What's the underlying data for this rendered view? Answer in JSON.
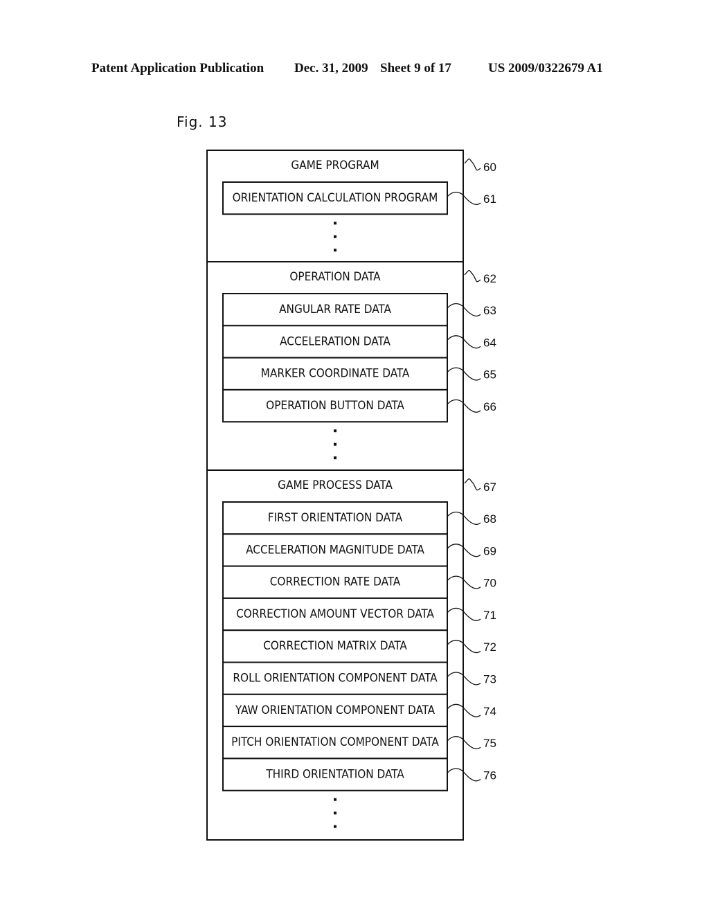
{
  "header": {
    "publication": "Patent Application Publication",
    "date": "Dec. 31, 2009",
    "sheet": "Sheet 9 of 17",
    "number": "US 2009/0322679 A1"
  },
  "figure": {
    "label": "Fig. 13",
    "sections": [
      {
        "title": "GAME PROGRAM",
        "ref": "60",
        "items": [
          {
            "label": "ORIENTATION CALCULATION PROGRAM",
            "ref": "61"
          }
        ],
        "continues": true
      },
      {
        "title": "OPERATION DATA",
        "ref": "62",
        "items": [
          {
            "label": "ANGULAR RATE DATA",
            "ref": "63"
          },
          {
            "label": "ACCELERATION DATA",
            "ref": "64"
          },
          {
            "label": "MARKER COORDINATE DATA",
            "ref": "65"
          },
          {
            "label": "OPERATION BUTTON DATA",
            "ref": "66"
          }
        ],
        "continues": true
      },
      {
        "title": "GAME PROCESS DATA",
        "ref": "67",
        "items": [
          {
            "label": "FIRST ORIENTATION DATA",
            "ref": "68"
          },
          {
            "label": "ACCELERATION MAGNITUDE DATA",
            "ref": "69"
          },
          {
            "label": "CORRECTION RATE DATA",
            "ref": "70"
          },
          {
            "label": "CORRECTION AMOUNT VECTOR DATA",
            "ref": "71"
          },
          {
            "label": "CORRECTION MATRIX DATA",
            "ref": "72"
          },
          {
            "label": "ROLL ORIENTATION COMPONENT DATA",
            "ref": "73"
          },
          {
            "label": "YAW ORIENTATION COMPONENT DATA",
            "ref": "74"
          },
          {
            "label": "PITCH ORIENTATION COMPONENT DATA",
            "ref": "75"
          },
          {
            "label": "THIRD ORIENTATION DATA",
            "ref": "76"
          }
        ],
        "continues": true
      }
    ]
  }
}
